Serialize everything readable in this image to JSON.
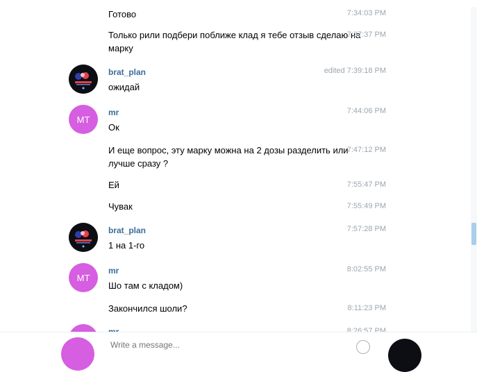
{
  "messages": [
    {
      "text": "Готово",
      "time": "7:34:03 PM"
    },
    {
      "text": "Только рили подбери поближе клад я тебе отзыв сделаю на марку",
      "time": "7:37:37 PM"
    },
    {
      "author": "brat_plan",
      "text": "ожидай",
      "edited": "edited",
      "time": "7:39:18 PM"
    },
    {
      "author": "mr",
      "avatar_initials": "MT",
      "text": "Ок",
      "time": "7:44:06 PM"
    },
    {
      "text": "И еще вопрос, эту марку можна на 2 дозы разделить или лучше сразу ?",
      "time": "7:47:12 PM"
    },
    {
      "text": "Ей",
      "time": "7:55:47 PM"
    },
    {
      "text": "Чувак",
      "time": "7:55:49 PM"
    },
    {
      "author": "brat_plan",
      "text": "1 на 1-го",
      "time": "7:57:28 PM"
    },
    {
      "author": "mr",
      "avatar_initials": "MT",
      "text": "Шо там с кладом)",
      "time": "8:02:55 PM"
    },
    {
      "text": "Закончился шоли?",
      "time": "8:11:23 PM"
    },
    {
      "author": "mr",
      "time": "8:26:57 PM"
    }
  ],
  "composer": {
    "placeholder": "Write a message..."
  },
  "icons": {
    "avatar_brat_plan": "brat-plan-avatar",
    "emoji": "smile-icon"
  },
  "colors": {
    "author": "#3a6d99",
    "time": "#9da6ad",
    "avatar_mt": "#d65ee0",
    "scroll_thumb": "#a9cdea"
  }
}
